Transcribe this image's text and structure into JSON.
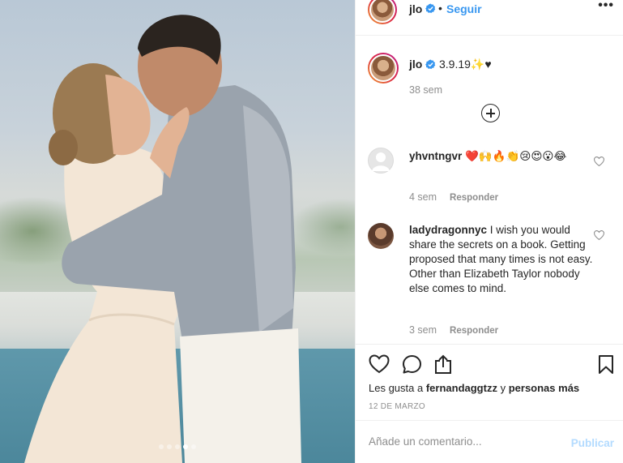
{
  "post": {
    "username": "jlo",
    "follow_label": "Seguir",
    "dot": "•",
    "more": "•••",
    "photo_dots": 5,
    "photo_active_dot": 3
  },
  "caption": {
    "username": "jlo",
    "text": "3.9.19✨♥",
    "time": "38 sem"
  },
  "comments": [
    {
      "username": "yhvntngvr",
      "text": "❤️🙌🔥👏😢😍😮😂",
      "time": "4 sem",
      "reply_label": "Responder"
    },
    {
      "username": "ladydragonnyc",
      "text": "I wish you would share the secrets on a book. Getting proposed that many times is not easy. Other than Elizabeth Taylor nobody else comes to mind.",
      "time": "3 sem",
      "reply_label": "Responder"
    }
  ],
  "likes": {
    "prefix": "Les gusta a",
    "user": "fernandaggtzz",
    "joiner": "y",
    "others": "personas más"
  },
  "date": "12 DE MARZO",
  "add_comment": {
    "placeholder": "Añade un comentario...",
    "publish_label": "Publicar"
  },
  "icons": {
    "like": "heart-icon",
    "comment": "comment-icon",
    "share": "share-icon",
    "save": "bookmark-icon",
    "verified": "verified-badge-icon",
    "load_more": "plus-circle-icon"
  },
  "colors": {
    "accent": "#3897f0",
    "publish_disabled": "#b3dbff",
    "text": "#262626",
    "muted": "#8e8e8e"
  }
}
